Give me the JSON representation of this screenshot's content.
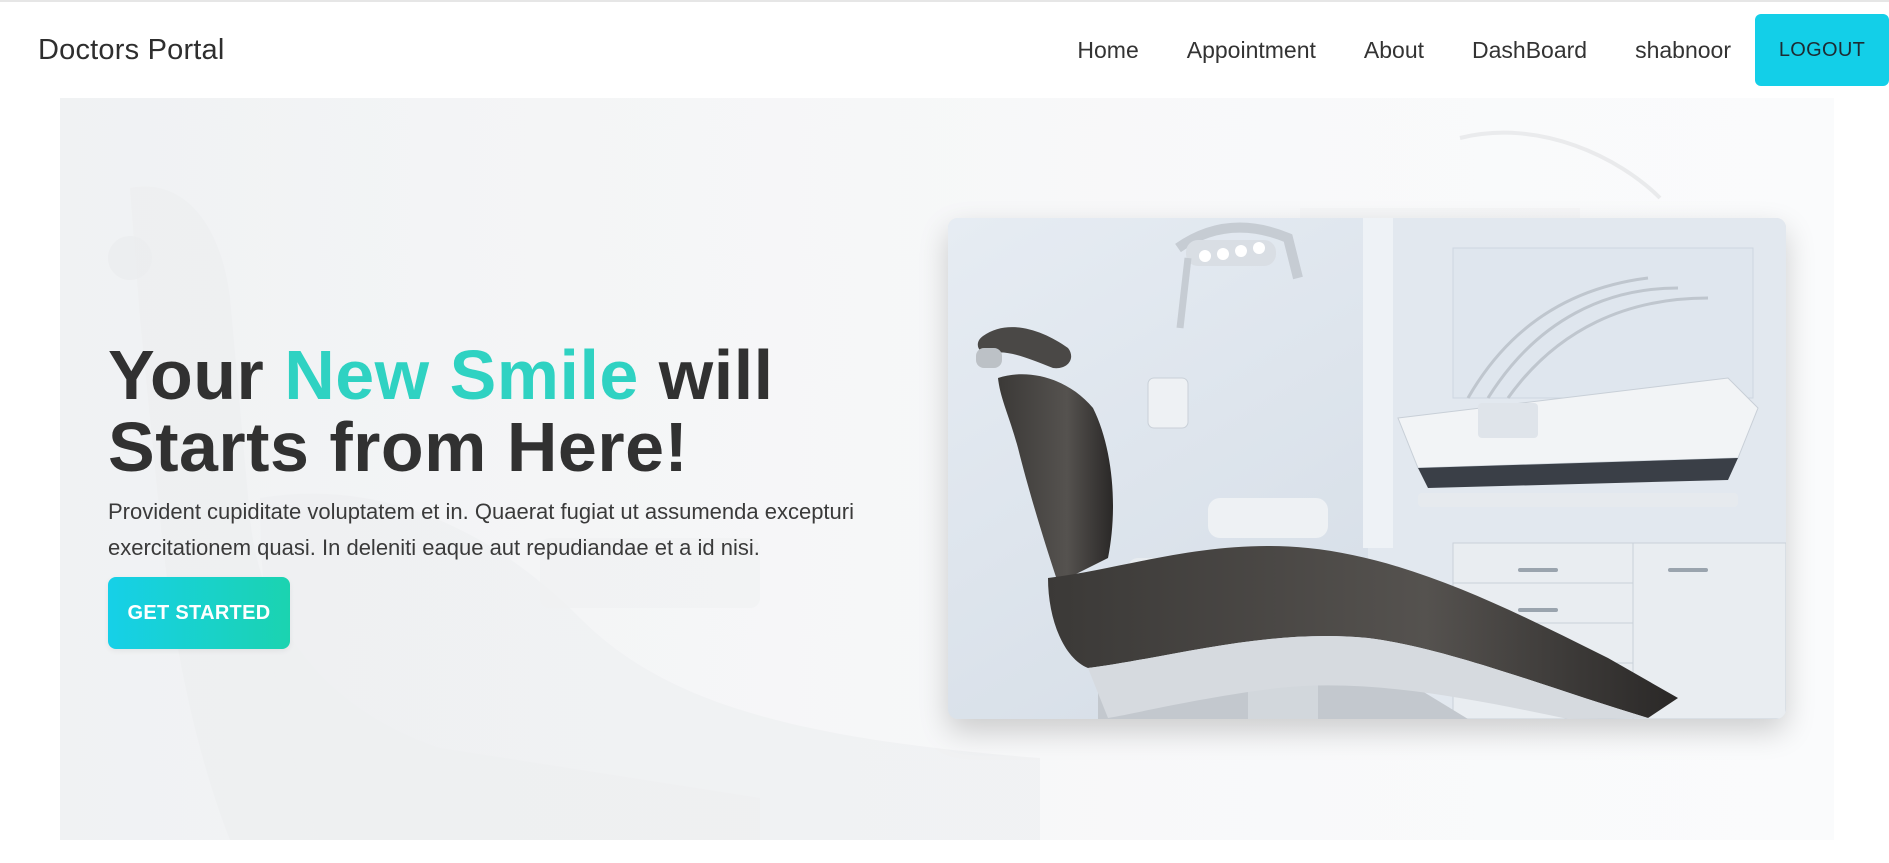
{
  "navbar": {
    "brand": "Doctors Portal",
    "links": [
      "Home",
      "Appointment",
      "About",
      "DashBoard",
      "shabnoor"
    ],
    "logout_label": "LOGOUT"
  },
  "hero": {
    "headline_part1": "Your ",
    "headline_accent": "New Smile",
    "headline_part2": " will",
    "headline_line2": "Starts from Here!",
    "subtext": "Provident cupiditate voluptatem et in. Quaerat fugiat ut assumenda excepturi exercitationem quasi. In deleniti eaque aut repudiandae et a id nisi.",
    "cta_label": "GET STARTED",
    "image_subject": "dental-chair-photo"
  },
  "colors": {
    "accent": "#2fd2c2",
    "button_cyan": "#13cfe8",
    "button_gradient_end": "#1bd3b0",
    "headline": "#313131"
  }
}
